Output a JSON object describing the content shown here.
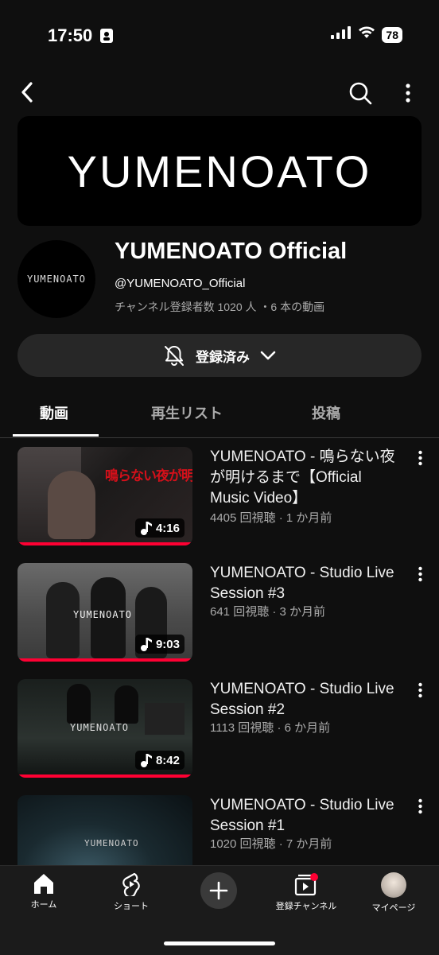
{
  "status": {
    "time": "17:50",
    "battery": "78"
  },
  "banner": {
    "text": "YUMENOATO"
  },
  "channel": {
    "avatar_text": "YUMENOATO",
    "name": "YUMENOATO Official",
    "handle": "@YUMENOATO_Official",
    "meta": "チャンネル登録者数 1020 人 ・6 本の動画",
    "subscribe_label": "登録済み"
  },
  "tabs": [
    {
      "label": "動画",
      "active": true
    },
    {
      "label": "再生リスト",
      "active": false
    },
    {
      "label": "投稿",
      "active": false
    }
  ],
  "videos": [
    {
      "title": "YUMENOATO - 鳴らない夜が明けるまで【Official Music Video】",
      "meta": "4405 回視聴 · 1 か月前",
      "duration": "4:16",
      "thumb_text": "鳴らない夜が明けるまで"
    },
    {
      "title": "YUMENOATO - Studio Live Session #3",
      "meta": "641 回視聴 · 3 か月前",
      "duration": "9:03",
      "thumb_text": "YUMENOATO"
    },
    {
      "title": "YUMENOATO - Studio Live Session #2",
      "meta": "1113 回視聴 · 6 か月前",
      "duration": "8:42",
      "thumb_text": "YUMENOATO"
    },
    {
      "title": "YUMENOATO - Studio Live Session #1",
      "meta": "1020 回視聴 · 7 か月前",
      "duration": "",
      "thumb_text": "YUMENOATO"
    }
  ],
  "nav": {
    "home": "ホーム",
    "shorts": "ショート",
    "subscriptions": "登録チャンネル",
    "mypage": "マイページ"
  },
  "colors": {
    "accent": "#ff0033",
    "background": "#0f0f0f",
    "surface": "#272727"
  }
}
